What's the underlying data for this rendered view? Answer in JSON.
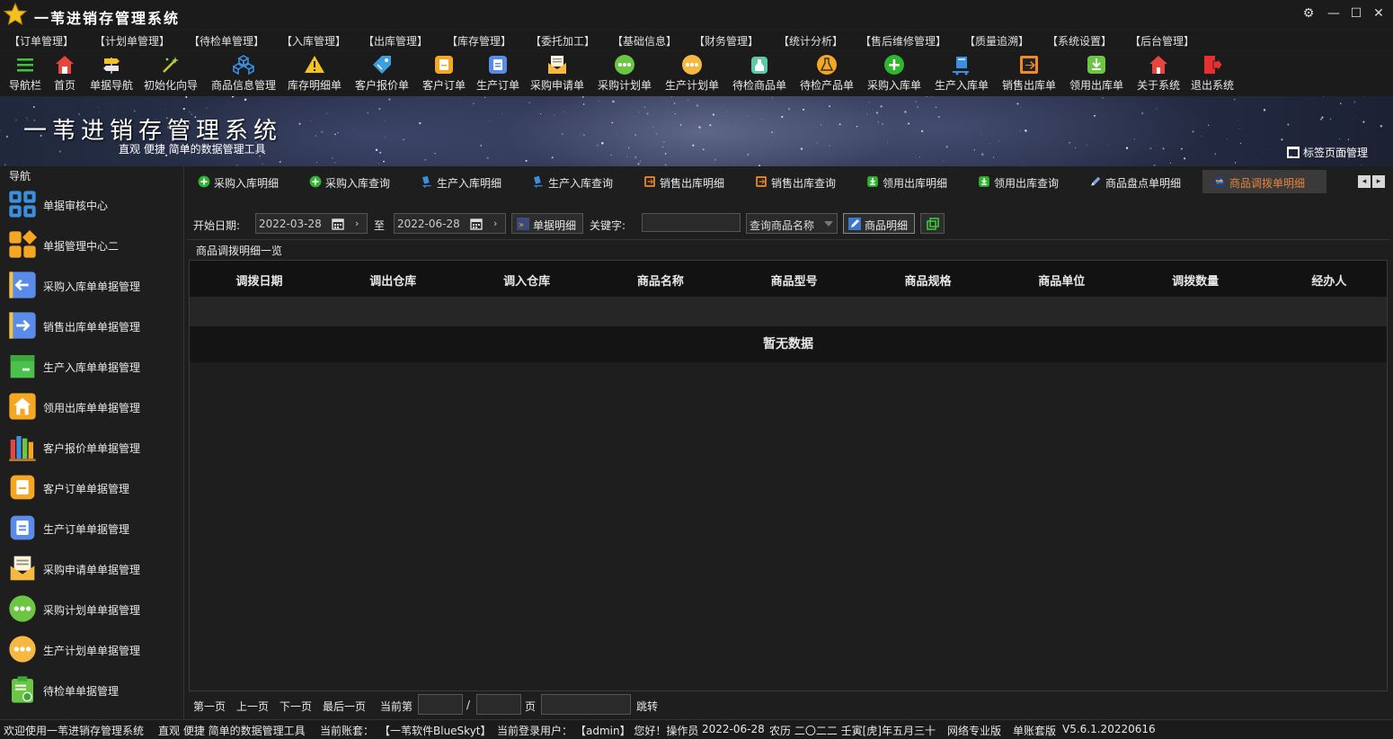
{
  "window": {
    "title": "一苇进销存管理系统"
  },
  "menu": [
    "【订单管理】",
    "【计划单管理】",
    "【待检单管理】",
    "【入库管理】",
    "【出库管理】",
    "【库存管理】",
    "【委托加工】",
    "【基础信息】",
    "【财务管理】",
    "【统计分析】",
    "【售后维修管理】",
    "【质量追溯】",
    "【系统设置】",
    "【后台管理】"
  ],
  "toolbar": [
    {
      "label": "导航栏",
      "icon": "hamburger-icon"
    },
    {
      "label": "首页",
      "icon": "home-icon"
    },
    {
      "label": "单据导航",
      "icon": "signpost-icon"
    },
    {
      "label": "初始化向导",
      "icon": "wand-icon"
    },
    {
      "label": "商品信息管理",
      "icon": "cubes-icon"
    },
    {
      "label": "库存明细单",
      "icon": "warning-icon"
    },
    {
      "label": "客户报价单",
      "icon": "tag-icon"
    },
    {
      "label": "客户订单",
      "icon": "doc-orange-icon"
    },
    {
      "label": "生产订单",
      "icon": "doc-blue-icon"
    },
    {
      "label": "采购申请单",
      "icon": "envelope-icon"
    },
    {
      "label": "采购计划单",
      "icon": "dots-green-icon"
    },
    {
      "label": "生产计划单",
      "icon": "dots-orange-icon"
    },
    {
      "label": "待检商品单",
      "icon": "bottle-icon"
    },
    {
      "label": "待检产品单",
      "icon": "flask-icon"
    },
    {
      "label": "采购入库单",
      "icon": "plus-circle-icon"
    },
    {
      "label": "生产入库单",
      "icon": "cart-icon"
    },
    {
      "label": "销售出库单",
      "icon": "box-out-icon"
    },
    {
      "label": "领用出库单",
      "icon": "download-icon"
    },
    {
      "label": "关于系统",
      "icon": "house-red-icon"
    },
    {
      "label": "退出系统",
      "icon": "exit-icon"
    }
  ],
  "banner": {
    "title": "一苇进销存管理系统",
    "subtitle": "直观 便捷 简单的数据管理工具",
    "tab_manager": "标签页面管理"
  },
  "sidebar": {
    "title": "导航",
    "items": [
      {
        "label": "单据审核中心",
        "icon": "grid-blue-icon"
      },
      {
        "label": "单据管理中心二",
        "icon": "grid-orange-icon"
      },
      {
        "label": "采购入库单单据管理",
        "icon": "arrow-left-icon"
      },
      {
        "label": "销售出库单单据管理",
        "icon": "arrow-right-icon"
      },
      {
        "label": "生产入库单单据管理",
        "icon": "folder-green-icon"
      },
      {
        "label": "领用出库单单据管理",
        "icon": "house-orange-icon"
      },
      {
        "label": "客户报价单单据管理",
        "icon": "books-icon"
      },
      {
        "label": "客户订单单据管理",
        "icon": "doc-orange-icon"
      },
      {
        "label": "生产订单单据管理",
        "icon": "doc-blue-icon"
      },
      {
        "label": "采购申请单单据管理",
        "icon": "envelope-icon"
      },
      {
        "label": "采购计划单单据管理",
        "icon": "dots-green-icon"
      },
      {
        "label": "生产计划单单据管理",
        "icon": "dots-orange-icon"
      },
      {
        "label": "待检单单据管理",
        "icon": "clipboard-icon"
      }
    ]
  },
  "tabs": [
    {
      "label": "采购入库明细",
      "icon": "plus-green-icon"
    },
    {
      "label": "采购入库查询",
      "icon": "plus-green-icon"
    },
    {
      "label": "生产入库明细",
      "icon": "cart-blue-icon"
    },
    {
      "label": "生产入库查询",
      "icon": "cart-blue-icon"
    },
    {
      "label": "销售出库明细",
      "icon": "box-orange-icon"
    },
    {
      "label": "销售出库查询",
      "icon": "box-orange-icon"
    },
    {
      "label": "领用出库明细",
      "icon": "download-green-icon"
    },
    {
      "label": "领用出库查询",
      "icon": "download-green-icon"
    },
    {
      "label": "商品盘点单明细",
      "icon": "pen-icon"
    },
    {
      "label": "商品调拨单明细",
      "icon": "transfer-icon",
      "active": true
    }
  ],
  "filter": {
    "start_label": "开始日期:",
    "start_date": "2022-03-28",
    "to_label": "至",
    "end_date": "2022-06-28",
    "detail_button": "单据明细",
    "keyword_label": "关键字:",
    "keyword_value": "",
    "query_select": "查询商品名称",
    "product_button": "商品明细"
  },
  "grid": {
    "title": "商品调拨明细一览",
    "columns": [
      "调拨日期",
      "调出仓库",
      "调入仓库",
      "商品名称",
      "商品型号",
      "商品规格",
      "商品单位",
      "调拨数量",
      "经办人"
    ],
    "empty_text": "暂无数据"
  },
  "pager": {
    "first": "第一页",
    "prev": "上一页",
    "next": "下一页",
    "last": "最后一页",
    "current_label": "当前第",
    "slash": "/",
    "page_label": "页",
    "jump": "跳转"
  },
  "status": {
    "welcome": "欢迎使用一苇进销存管理系统",
    "slogan": "直观 便捷 简单的数据管理工具",
    "account_label": "当前账套：",
    "account": "【一苇软件BlueSkyt】",
    "user_label": "当前登录用户：",
    "user": "【admin】 您好！操作员",
    "date": "2022-06-28",
    "lunar": "农历 二〇二二 壬寅[虎]年五月三十",
    "edition": "网络专业版",
    "mode": "单账套版",
    "version": "V5.6.1.20220616"
  },
  "colors": {
    "accent_tab": "#e8843a",
    "background": "#1e1e1e"
  }
}
